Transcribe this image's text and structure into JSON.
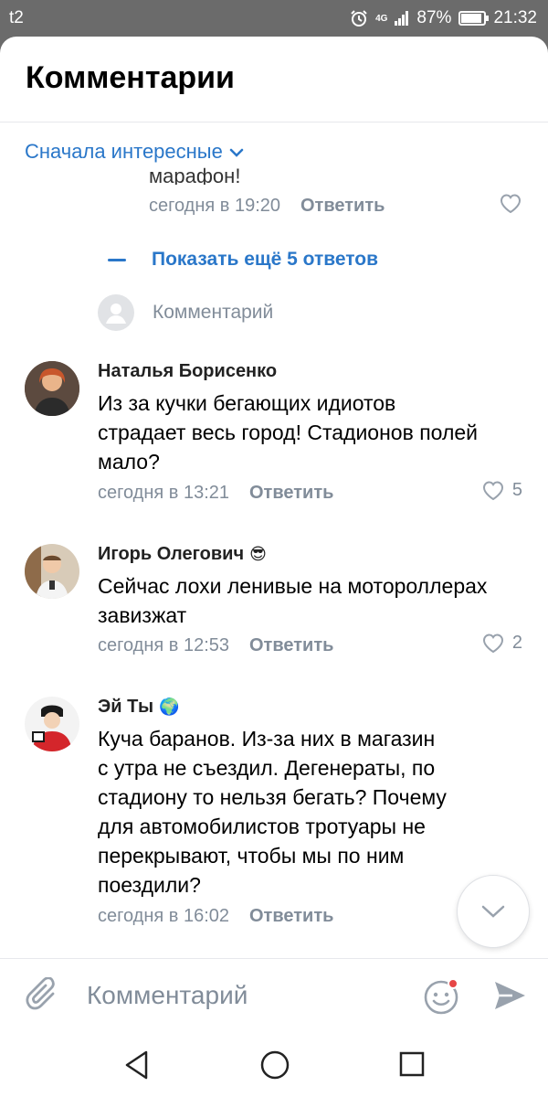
{
  "status_bar": {
    "carrier": "t2",
    "network": "4G",
    "battery": "87%",
    "time": "21:32"
  },
  "header": {
    "title": "Комментарии"
  },
  "sort": {
    "label": "Сначала интересные"
  },
  "thread": {
    "cut_text": "марафон!",
    "time": "сегодня в 19:20",
    "reply": "Ответить",
    "show_more": "Показать ещё 5 ответов",
    "reply_placeholder": "Комментарий"
  },
  "comments": [
    {
      "author": "Наталья Борисенко",
      "lines": [
        "Из за кучки бегающих идиотов",
        "страдает весь город!  Стадионов полей",
        "мало?"
      ],
      "time": "сегодня в 13:21",
      "reply": "Ответить",
      "likes": "5"
    },
    {
      "author": "Игорь Олегович",
      "emoji": "😎",
      "lines": [
        "Сейчас лохи ленивые на мотороллерах",
        "завизжат"
      ],
      "time": "сегодня в 12:53",
      "reply": "Ответить",
      "likes": "2"
    },
    {
      "author": "Эй Ты",
      "emoji": "🌍",
      "lines": [
        "Куча баранов. Из-за них в магазин",
        "с утра не съездил. Дегенераты, по",
        "стадиону то нельзя бегать? Почему",
        "для автомобилистов тротуары не",
        "перекрывают, чтобы мы по ним",
        "поездили?"
      ],
      "time": "сегодня в 16:02",
      "reply": "Ответить",
      "likes": ""
    }
  ],
  "composer": {
    "placeholder": "Комментарий"
  },
  "colors": {
    "accent": "#2a77c9",
    "secondary_text": "#818c99",
    "status_bar": "#6b6b6b"
  },
  "icons": [
    "alarm-icon",
    "signal-icon",
    "battery-icon",
    "chevron-down-icon",
    "heart-icon",
    "attach-icon",
    "emoji-icon",
    "send-icon",
    "back-icon",
    "home-icon",
    "recents-icon"
  ]
}
